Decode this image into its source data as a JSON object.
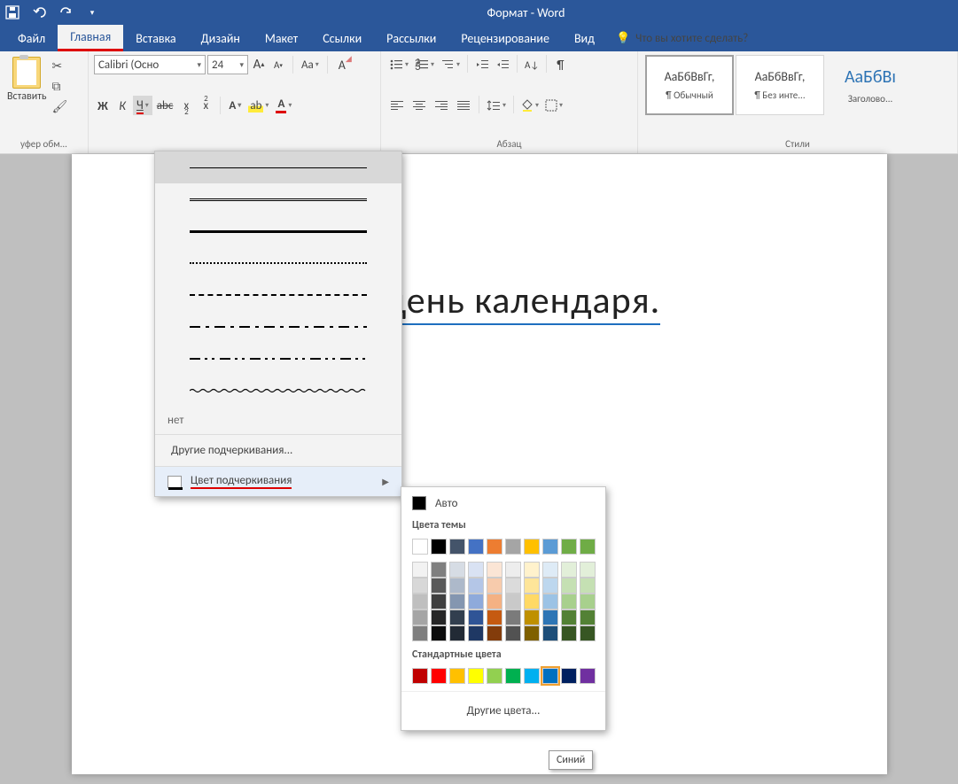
{
  "title": "Формат - Word",
  "tabs": [
    "Файл",
    "Главная",
    "Вставка",
    "Дизайн",
    "Макет",
    "Ссылки",
    "Рассылки",
    "Рецензирование",
    "Вид"
  ],
  "active_tab": 1,
  "tell_me": "Что вы хотите сделать?",
  "clipboard": {
    "paste": "Вставить",
    "group": "уфер обм..."
  },
  "font": {
    "name": "Calibri (Осно",
    "size": "24",
    "bold": "Ж",
    "italic": "К",
    "underline": "Ч",
    "strike": "abc",
    "x": "x",
    "A": "A",
    "aa": "Aa",
    "clear": "A",
    "effect": "A",
    "highlight": "ab",
    "color": "A"
  },
  "paragraph": {
    "group": "Абзац"
  },
  "styles": {
    "group": "Стили",
    "items": [
      {
        "sample": "АаБбВвГг,",
        "name": "¶ Обычный"
      },
      {
        "sample": "АаБбВвГг,",
        "name": "¶ Без инте..."
      },
      {
        "sample": "АаБбВı",
        "name": "Заголово..."
      }
    ]
  },
  "document_text": "й день календаря.",
  "underline_menu": {
    "none": "нет",
    "more": "Другие подчеркивания...",
    "color": "Цвет подчеркивания"
  },
  "color_popup": {
    "auto": "Авто",
    "theme": "Цвета темы",
    "standard": "Стандартные цвета",
    "more": "Другие цвета...",
    "theme_row1": [
      "#ffffff",
      "#000000",
      "#44546a",
      "#4472c4",
      "#ed7d31",
      "#a5a5a5",
      "#ffc000",
      "#5b9bd5",
      "#70ad47",
      "#6fac46"
    ],
    "theme_shades": [
      [
        "#f2f2f2",
        "#7f7f7f",
        "#d6dce4",
        "#d9e2f3",
        "#fbe5d5",
        "#ededed",
        "#fff2cc",
        "#deebf6",
        "#e2efd9",
        "#e2efd9"
      ],
      [
        "#d8d8d8",
        "#595959",
        "#adb9ca",
        "#b4c6e7",
        "#f7cbac",
        "#dbdbdb",
        "#fee599",
        "#bdd7ee",
        "#c5e0b3",
        "#c5e0b3"
      ],
      [
        "#bfbfbf",
        "#3f3f3f",
        "#8496b0",
        "#8eaadb",
        "#f4b183",
        "#c9c9c9",
        "#ffd965",
        "#9cc3e5",
        "#a8d08d",
        "#a8d08d"
      ],
      [
        "#a5a5a5",
        "#262626",
        "#323f4f",
        "#2f5496",
        "#c55a11",
        "#7b7b7b",
        "#bf9000",
        "#2e75b5",
        "#538135",
        "#538135"
      ],
      [
        "#7f7f7f",
        "#0c0c0c",
        "#222a35",
        "#1f3864",
        "#833c0b",
        "#525252",
        "#7f6000",
        "#1e4e79",
        "#375623",
        "#375623"
      ]
    ],
    "standard_colors": [
      "#c00000",
      "#ff0000",
      "#ffc000",
      "#ffff00",
      "#92d050",
      "#00b050",
      "#00b0f0",
      "#0070c0",
      "#002060",
      "#7030a0"
    ],
    "selected_standard": 7
  },
  "tooltip": "Синий"
}
